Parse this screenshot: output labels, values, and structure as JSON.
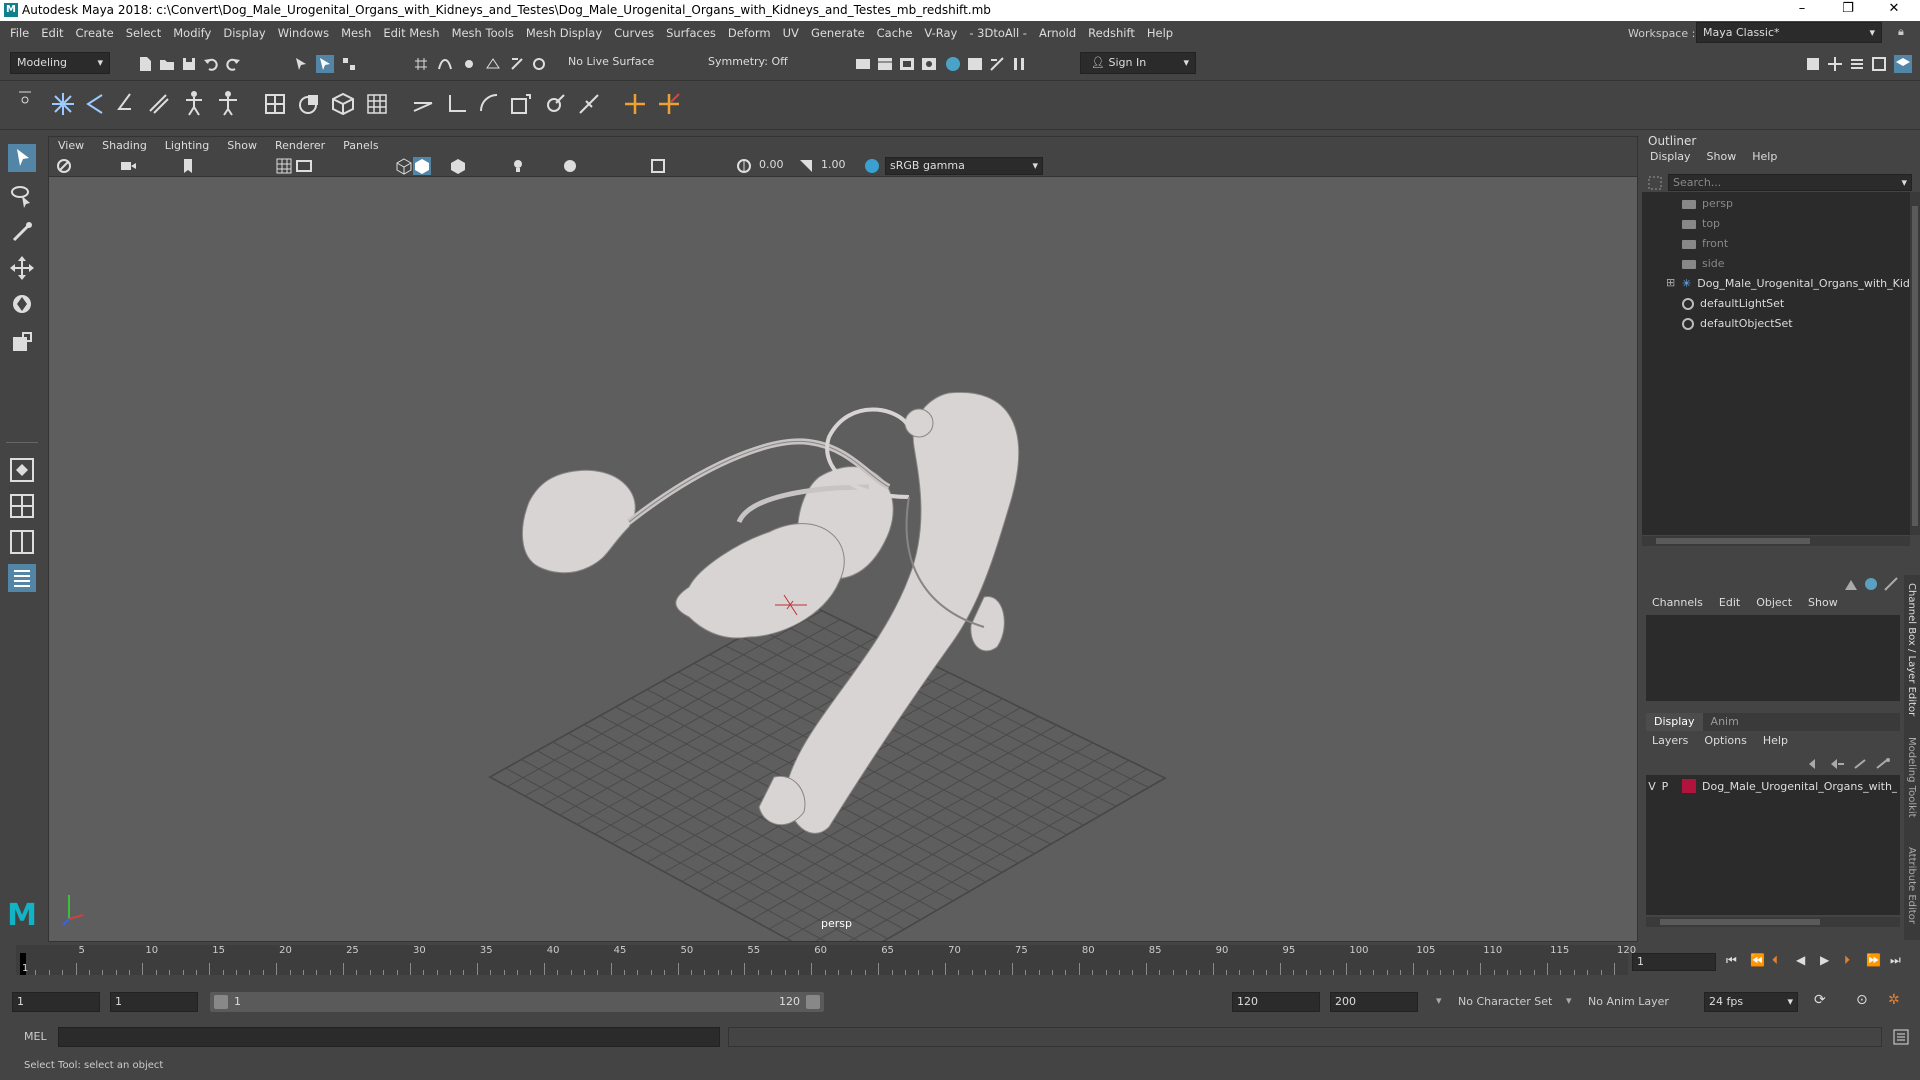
{
  "titlebar": {
    "title": "Autodesk Maya 2018: c:\\Convert\\Dog_Male_Urogenital_Organs_with_Kidneys_and_Testes\\Dog_Male_Urogenital_Organs_with_Kidneys_and_Testes_mb_redshift.mb",
    "logo": "M",
    "minimize": "–",
    "maximize": "❐",
    "close": "✕"
  },
  "menubar": {
    "items": [
      "File",
      "Edit",
      "Create",
      "Select",
      "Modify",
      "Display",
      "Windows",
      "Mesh",
      "Edit Mesh",
      "Mesh Tools",
      "Mesh Display",
      "Curves",
      "Surfaces",
      "Deform",
      "UV",
      "Generate",
      "Cache",
      "V-Ray",
      "- 3DtoAll -",
      "Arnold",
      "Redshift",
      "Help"
    ],
    "workspace_label": "Workspace :",
    "workspace_value": "Maya Classic*"
  },
  "statusline": {
    "mode": "Modeling",
    "live_surface": "No Live Surface",
    "symmetry": "Symmetry: Off",
    "sign_in": "Sign In"
  },
  "viewport": {
    "menu": [
      "View",
      "Shading",
      "Lighting",
      "Show",
      "Renderer",
      "Panels"
    ],
    "exposure": "0.00",
    "gamma": "1.00",
    "colorspace": "sRGB gamma",
    "camera_label": "persp"
  },
  "outliner": {
    "title": "Outliner",
    "menu": [
      "Display",
      "Show",
      "Help"
    ],
    "search_placeholder": "Search...",
    "items": [
      {
        "label": "persp",
        "type": "camera"
      },
      {
        "label": "top",
        "type": "camera"
      },
      {
        "label": "front",
        "type": "camera"
      },
      {
        "label": "side",
        "type": "camera"
      },
      {
        "label": "Dog_Male_Urogenital_Organs_with_Kid",
        "type": "group"
      },
      {
        "label": "defaultLightSet",
        "type": "set"
      },
      {
        "label": "defaultObjectSet",
        "type": "set"
      }
    ]
  },
  "channelbox": {
    "menu": [
      "Channels",
      "Edit",
      "Object",
      "Show"
    ],
    "tabs": [
      "Display",
      "Anim"
    ],
    "layer_menu": [
      "Layers",
      "Options",
      "Help"
    ],
    "layer": {
      "v": "V",
      "p": "P",
      "name": "Dog_Male_Urogenital_Organs_with_",
      "color": "#b0143c"
    }
  },
  "right_tabs": [
    "Channel Box / Layer Editor",
    "Modeling Toolkit",
    "Attribute Editor"
  ],
  "timeslider": {
    "ticks": [
      "5",
      "10",
      "15",
      "20",
      "25",
      "30",
      "35",
      "40",
      "45",
      "50",
      "55",
      "60",
      "65",
      "70",
      "75",
      "80",
      "85",
      "90",
      "95",
      "100",
      "105",
      "110",
      "115",
      "120"
    ],
    "current_marker": "1",
    "current_frame": "1"
  },
  "range": {
    "start": "1",
    "playback_start": "1",
    "slider_start": "1",
    "slider_end": "120",
    "playback_end": "120",
    "end": "200",
    "character_set": "No Character Set",
    "anim_layer": "No Anim Layer",
    "fps": "24 fps"
  },
  "cmdline": {
    "label": "MEL"
  },
  "helpline": {
    "text": "Select Tool: select an object"
  }
}
